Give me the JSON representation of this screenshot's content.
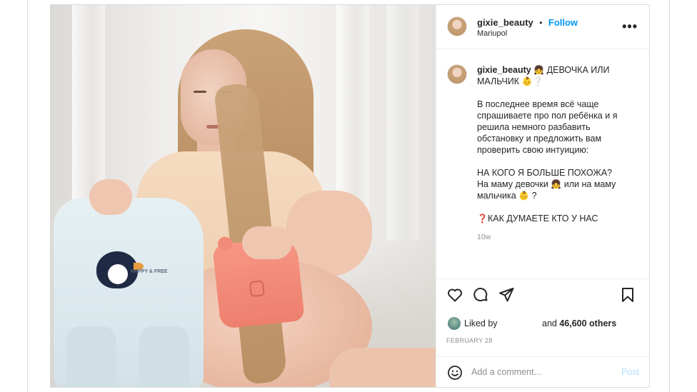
{
  "header": {
    "username": "gixie_beauty",
    "separator": "•",
    "follow_label": "Follow",
    "location": "Mariupol",
    "more_glyph": "•••"
  },
  "caption": {
    "username": "gixie_beauty",
    "title_line1": "ДЕВОЧКА ИЛИ",
    "title_line2": "МАЛЬЧИК",
    "title_emoji1": "👧",
    "title_emoji2": "👶",
    "title_emoji3": "❔",
    "paragraph1": "В последнее время всё чаще\nспрашиваете про пол ребёнка и я\nрешила немного разбавить\nобстановку и предложить вам\nпроверить свою интуицию:",
    "question_line": "НА КОГО Я БОЛЬШЕ ПОХОЖА?",
    "mom_girl_prefix": "На маму девочки",
    "mom_girl_emoji": "👧",
    "mom_boy_middle": "или на маму",
    "mom_boy_line2_prefix": "мальчика",
    "mom_boy_emoji": "👶",
    "mom_boy_suffix": "?",
    "final_emoji": "❓",
    "final_line": "КАК ДУМАЕТЕ КТО У НАС",
    "time_ago": "10w"
  },
  "likes": {
    "liked_by_label": "Liked by",
    "and_label": "and",
    "count_label": "46,600 others"
  },
  "date": "FEBRUARY 28",
  "comment": {
    "placeholder": "Add a comment...",
    "post_label": "Post"
  },
  "photo": {
    "romper_print": "HAPPY & FREE"
  },
  "icons": {
    "heart": "heart-icon",
    "comment": "comment-icon",
    "share": "share-icon",
    "save": "bookmark-icon",
    "emoji": "emoji-icon"
  },
  "colors": {
    "accent": "#0095f6",
    "post_disabled": "#b2dffc",
    "border": "#dbdbdb",
    "muted": "#8e8e8e"
  }
}
